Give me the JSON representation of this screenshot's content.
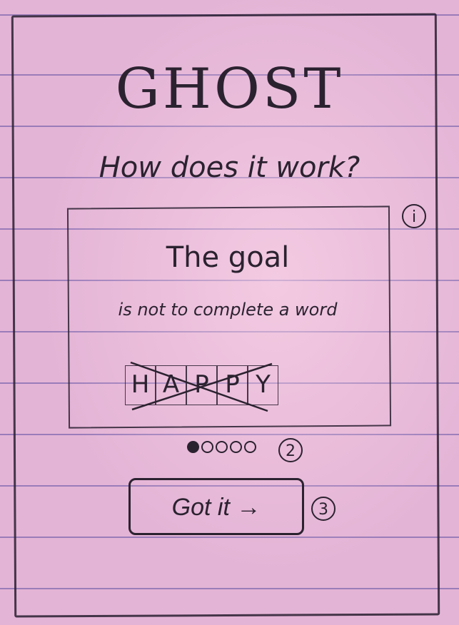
{
  "app": {
    "title": "GHOST"
  },
  "intro": {
    "heading": "How does it work?"
  },
  "card": {
    "heading": "The goal",
    "body": "is not to complete a word",
    "example_letters": [
      "H",
      "A",
      "P",
      "P",
      "Y"
    ]
  },
  "pager": {
    "total": 5,
    "current": 1
  },
  "cta": {
    "label": "Got it →"
  },
  "callouts": {
    "info": "i",
    "pager": "2",
    "button": "3"
  }
}
